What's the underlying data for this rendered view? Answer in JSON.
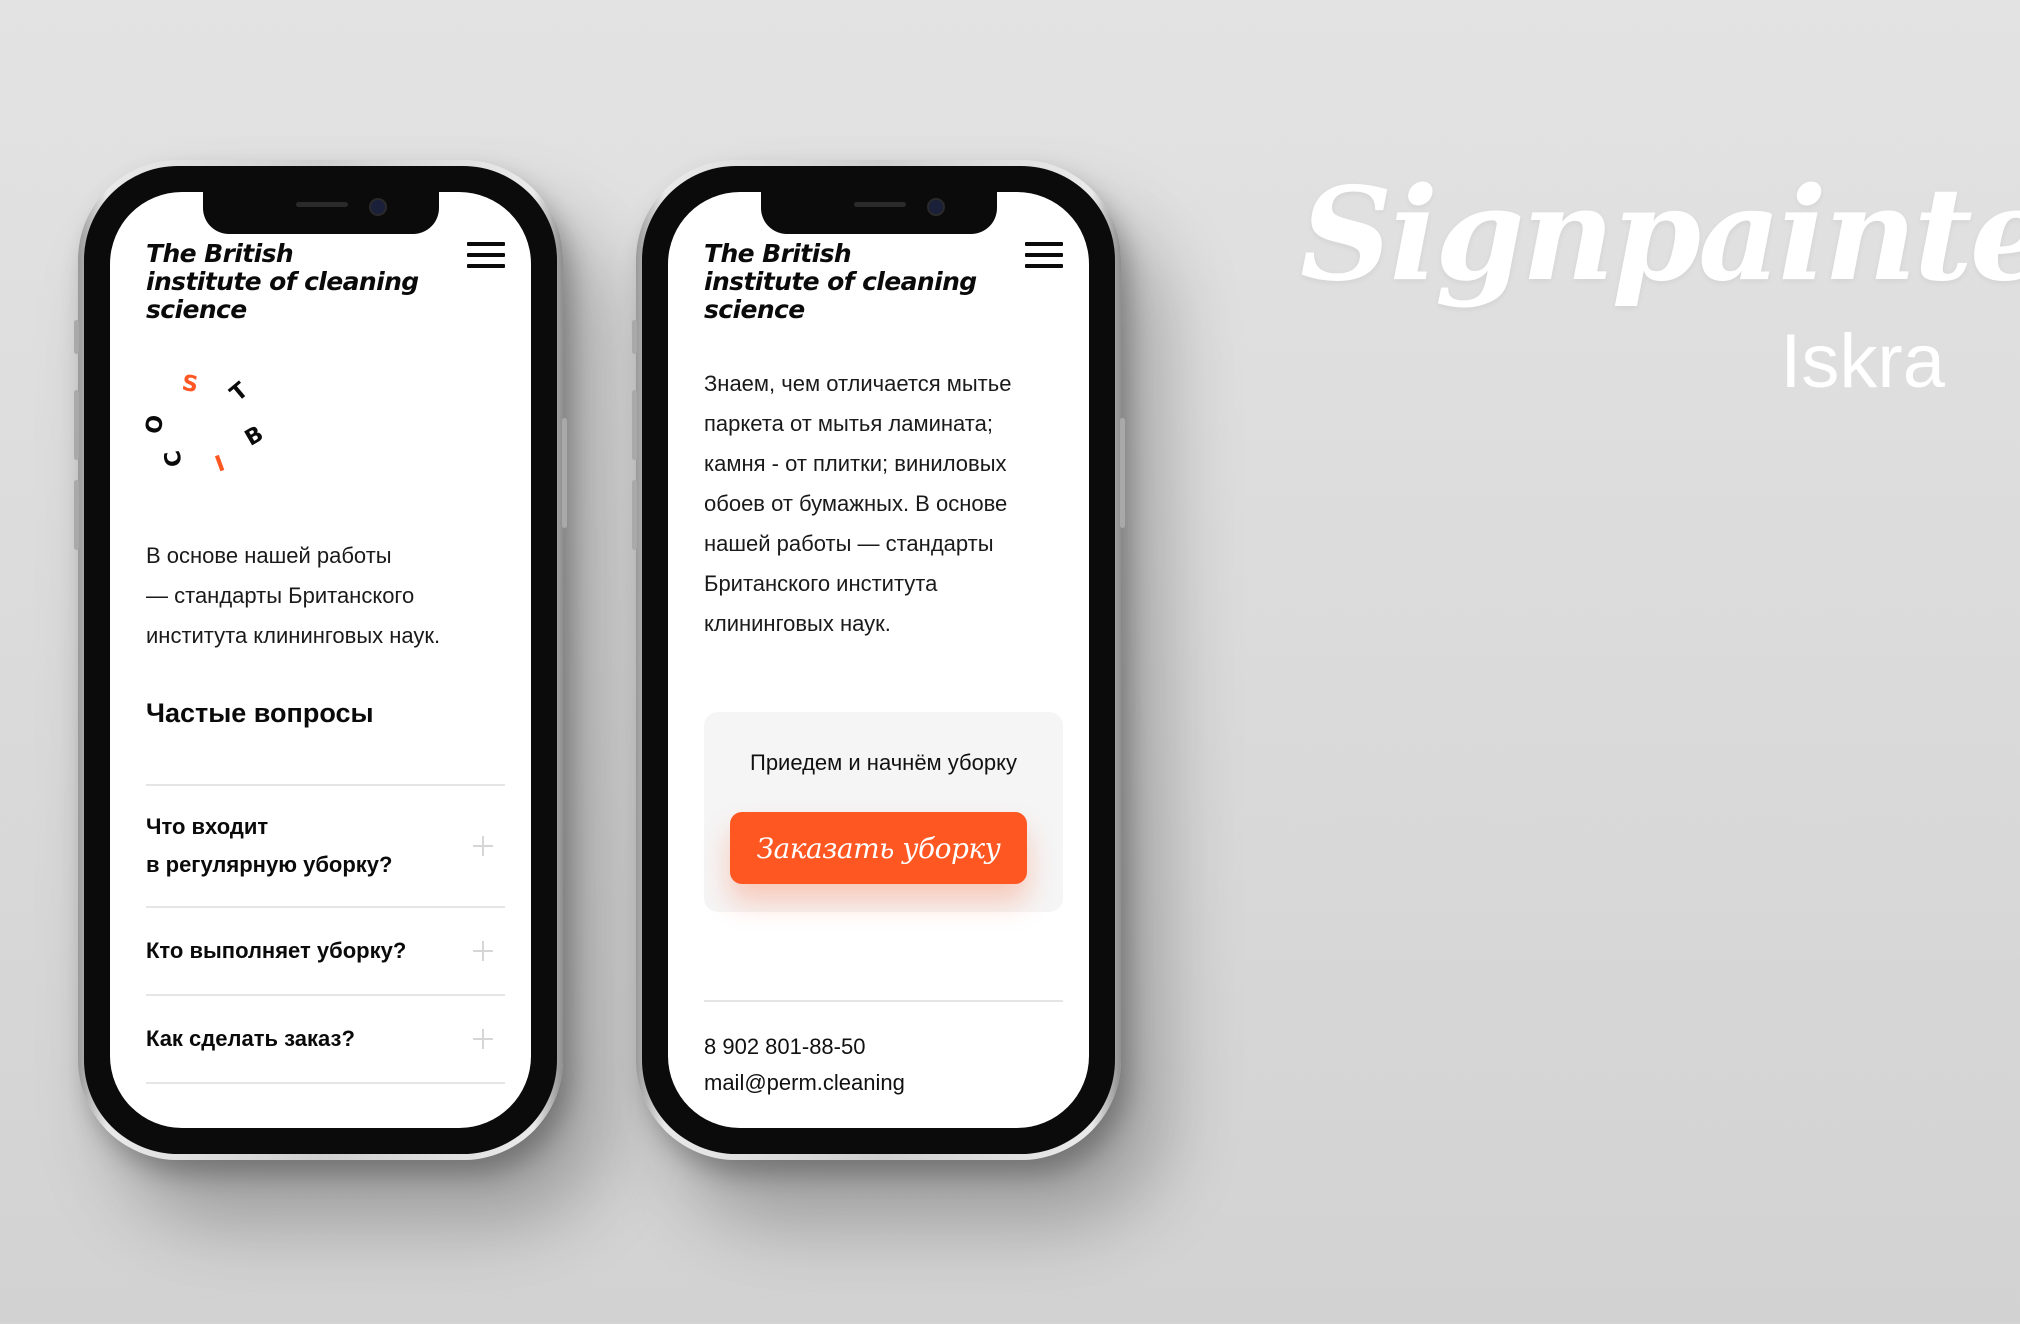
{
  "background": {
    "top": "#e3e3e3",
    "bottom": "#d2d2d2"
  },
  "accent_color": "#ff5722",
  "headline": {
    "font_name": "Signpainter",
    "subtitle": "Iskra"
  },
  "phone1": {
    "logo": [
      "The British",
      "institute of cleaning",
      "science"
    ],
    "menu_icon": "hamburger-icon",
    "scatter_letters": [
      "S",
      "T",
      "O",
      "B",
      "I",
      "C"
    ],
    "intro_lines": [
      "В основе нашей работы",
      "— стандарты Британского",
      "института клининговых наук."
    ],
    "faq_title": "Частые вопросы",
    "faq": [
      {
        "lines": [
          "Что входит",
          "в регулярную уборку?"
        ],
        "icon": "plus-icon"
      },
      {
        "lines": [
          "Кто выполняет уборку?"
        ],
        "icon": "plus-icon"
      },
      {
        "lines": [
          "Как сделать заказ?"
        ],
        "icon": "plus-icon"
      }
    ]
  },
  "phone2": {
    "logo": [
      "The British",
      "institute of cleaning",
      "science"
    ],
    "menu_icon": "hamburger-icon",
    "text_lines": [
      "Знаем, чем отличается мытье",
      "паркета от мытья ламината;",
      "камня - от плитки; виниловых",
      "обоев от бумажных. В основе",
      "нашей работы — стандарты",
      "Британского института",
      "клининговых наук."
    ],
    "cta_text": "Приедем и начнём уборку",
    "cta_button": "Заказать уборку",
    "phone": "8 902 801-88-50",
    "email": "mail@perm.cleaning"
  }
}
